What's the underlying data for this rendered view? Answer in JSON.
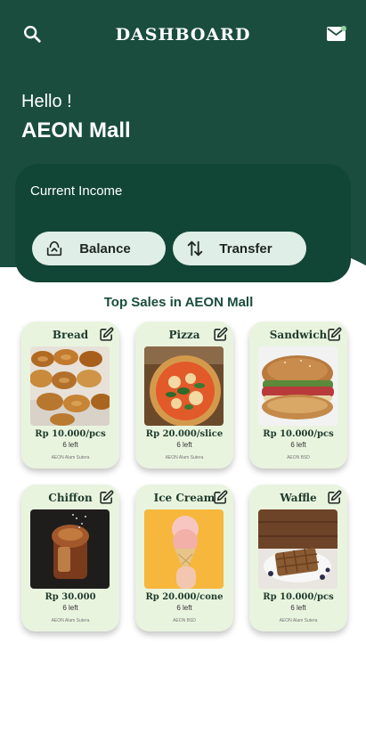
{
  "header": {
    "title": "DASHBOARD",
    "search_icon": "search-icon",
    "mail_icon": "mail-icon",
    "mail_badge_color": "#8fd19e"
  },
  "greeting": {
    "hello": "Hello !",
    "store": "AEON Mall"
  },
  "income": {
    "label": "Current Income",
    "balance_label": "Balance",
    "transfer_label": "Transfer",
    "balance_icon": "wallet-upload-icon",
    "transfer_icon": "swap-arrows-icon"
  },
  "section": {
    "title": "Top Sales in AEON Mall"
  },
  "products": [
    {
      "name": "Bread",
      "price": "Rp 10.000/pcs",
      "stock": "6 left",
      "location": "AEON Alam Sutera",
      "image": "bread-photo"
    },
    {
      "name": "Pizza",
      "price": "Rp 20.000/slice",
      "stock": "6 left",
      "location": "AEON Alam Sutera",
      "image": "pizza-photo"
    },
    {
      "name": "Sandwich",
      "price": "Rp 10.000/pcs",
      "stock": "6 left",
      "location": "AEON BSD",
      "image": "sandwich-photo"
    },
    {
      "name": "Chiffon",
      "price": "Rp 30.000",
      "stock": "6 left",
      "location": "AEON Alam Sutera",
      "image": "chiffon-photo"
    },
    {
      "name": "Ice Cream",
      "price": "Rp 20.000/cone",
      "stock": "6 left",
      "location": "AEON BSD",
      "image": "ice-cream-photo"
    },
    {
      "name": "Waffle",
      "price": "Rp 10.000/pcs",
      "stock": "6 left",
      "location": "AEON Alam Sutera",
      "image": "waffle-photo"
    }
  ],
  "colors": {
    "primary": "#1a4d3e",
    "card_dark": "#114536",
    "pill": "#dfeee6",
    "product_card": "#e9f4df"
  }
}
